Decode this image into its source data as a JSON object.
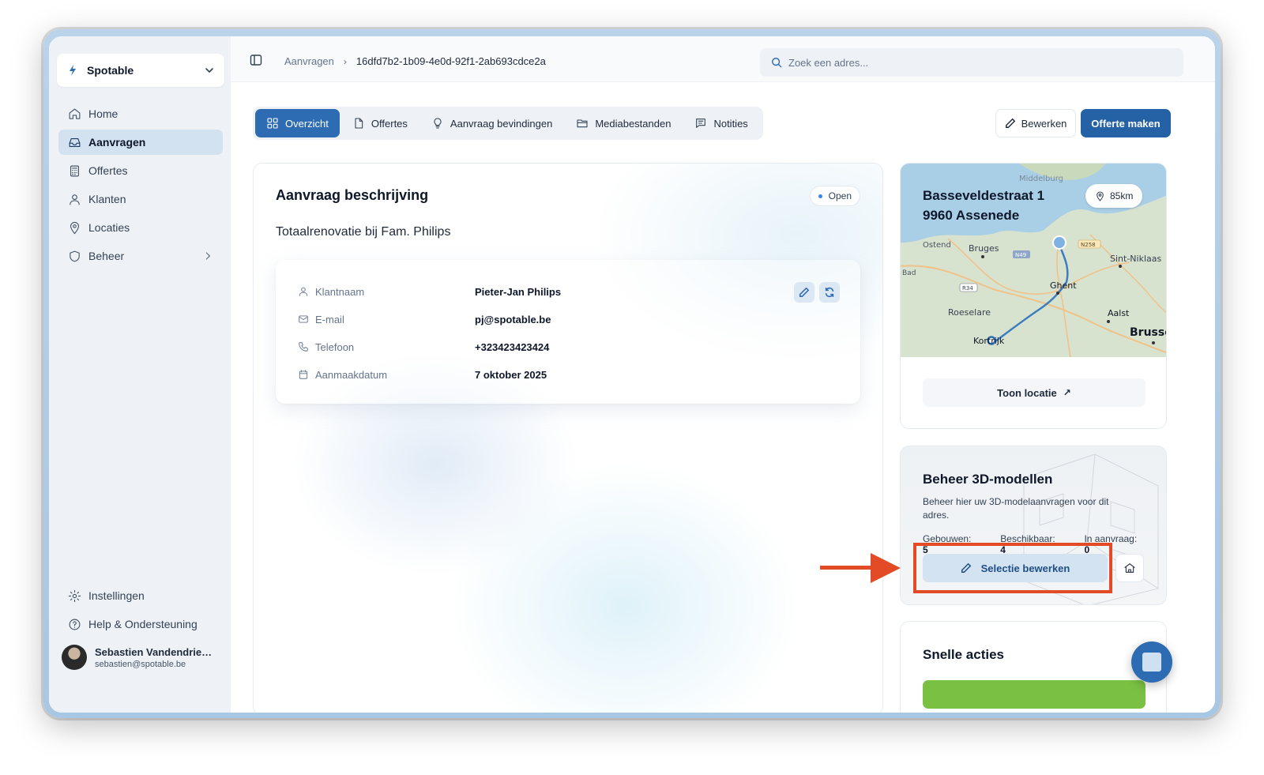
{
  "colors": {
    "accent": "#2d6bb3",
    "primary_button": "#2561a5",
    "annotation": "#e24b26",
    "open_dot": "#3b82f6"
  },
  "org": {
    "name": "Spotable"
  },
  "sidebar": {
    "items": [
      {
        "label": "Home",
        "icon": "home-icon"
      },
      {
        "label": "Aanvragen",
        "icon": "inbox-icon"
      },
      {
        "label": "Offertes",
        "icon": "calculator-icon"
      },
      {
        "label": "Klanten",
        "icon": "user-icon"
      },
      {
        "label": "Locaties",
        "icon": "map-pin-icon"
      },
      {
        "label": "Beheer",
        "icon": "shield-icon"
      }
    ],
    "bottom": [
      {
        "label": "Instellingen",
        "icon": "gear-icon"
      },
      {
        "label": "Help & Ondersteuning",
        "icon": "help-circle-icon"
      }
    ],
    "user": {
      "name": "Sebastien Vandendriess...",
      "email": "sebastien@spotable.be"
    }
  },
  "topbar": {
    "breadcrumb": {
      "parent": "Aanvragen",
      "current": "16dfd7b2-1b09-4e0d-92f1-2ab693cdce2a"
    },
    "search": {
      "placeholder": "Zoek een adres..."
    }
  },
  "tabs": [
    {
      "label": "Overzicht",
      "icon": "grid-icon"
    },
    {
      "label": "Offertes",
      "icon": "file-icon"
    },
    {
      "label": "Aanvraag bevindingen",
      "icon": "lightbulb-icon"
    },
    {
      "label": "Mediabestanden",
      "icon": "folder-icon"
    },
    {
      "label": "Notities",
      "icon": "notes-icon"
    }
  ],
  "actions": {
    "edit": "Bewerken",
    "create_quote": "Offerte maken"
  },
  "description": {
    "title": "Aanvraag beschrijving",
    "status": "Open",
    "subtitle": "Totaalrenovatie bij Fam. Philips",
    "fields": [
      {
        "label": "Klantnaam",
        "value": "Pieter-Jan Philips"
      },
      {
        "label": "E-mail",
        "value": "pj@spotable.be"
      },
      {
        "label": "Telefoon",
        "value": "+323423423424"
      },
      {
        "label": "Aanmaakdatum",
        "value": "7 oktober 2025"
      }
    ]
  },
  "location": {
    "street": "Basseveldestraat 1",
    "city": "9960 Assenede",
    "distance": "85km",
    "show_label": "Toon locatie",
    "map_labels": [
      "Middelburg",
      "Ostend",
      "Bruges",
      "Sint-Niklaas",
      "Ghent",
      "Roeselare",
      "Aalst",
      "Kortrijk",
      "Brusse",
      "Bad",
      "N49",
      "N258",
      "R34"
    ]
  },
  "models": {
    "title": "Beheer 3D-modellen",
    "description": "Beheer hier uw 3D-modelaanvragen voor dit adres.",
    "stats": [
      {
        "label": "Gebouwen:",
        "value": "5"
      },
      {
        "label": "Beschikbaar:",
        "value": "4"
      },
      {
        "label": "In aanvraag:",
        "value": "0"
      }
    ],
    "edit_selection": "Selectie bewerken"
  },
  "quick_actions": {
    "title": "Snelle acties"
  }
}
